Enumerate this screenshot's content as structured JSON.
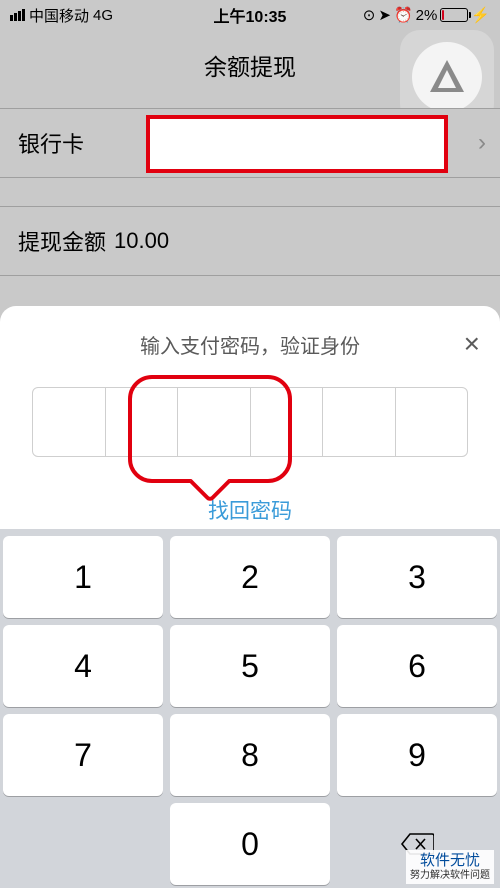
{
  "status": {
    "carrier": "中国移动",
    "network": "4G",
    "time": "上午10:35",
    "battery_pct": "2%"
  },
  "nav": {
    "title": "余额提现"
  },
  "rows": {
    "bankcard_label": "银行卡",
    "amount_label": "提现金额",
    "amount_value": "10.00"
  },
  "modal": {
    "title": "输入支付密码，验证身份",
    "close_glyph": "×",
    "recover_link": "找回密码"
  },
  "keypad": {
    "keys": [
      "1",
      "2",
      "3",
      "4",
      "5",
      "6",
      "7",
      "8",
      "9",
      "",
      "0",
      ""
    ]
  },
  "watermark": {
    "line1": "软件无忧",
    "line2": "努力解决软件问题"
  }
}
